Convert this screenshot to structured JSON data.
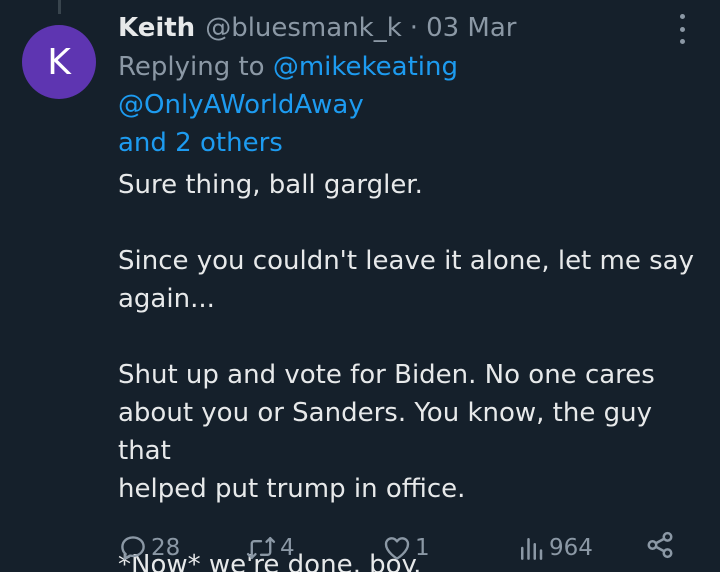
{
  "avatar": {
    "initial": "K",
    "color": "#5e35b1"
  },
  "author": {
    "display_name": "Keith",
    "handle": "@bluesmank_k",
    "separator": "·",
    "date": "03 Mar"
  },
  "replying": {
    "prefix": "Replying to ",
    "mentions": [
      "@mikekeating",
      "@OnlyAWorldAway"
    ],
    "others": "and 2 others"
  },
  "tweet": {
    "paragraphs": [
      [
        "Sure thing, ball gargler."
      ],
      [
        "Since you couldn't leave it alone, let me say",
        "again..."
      ],
      [
        "Shut up and vote for Biden. No one cares",
        "about you or Sanders. You know, the guy that",
        "helped put trump in office."
      ],
      [
        "*Now* we're done, boy."
      ]
    ]
  },
  "actions": {
    "replies": "28",
    "retweets": "4",
    "likes": "1",
    "views": "964"
  },
  "colors": {
    "background": "#15202b",
    "text": "#e7e9ea",
    "secondary": "#8b98a5",
    "link": "#1d9bf0"
  }
}
